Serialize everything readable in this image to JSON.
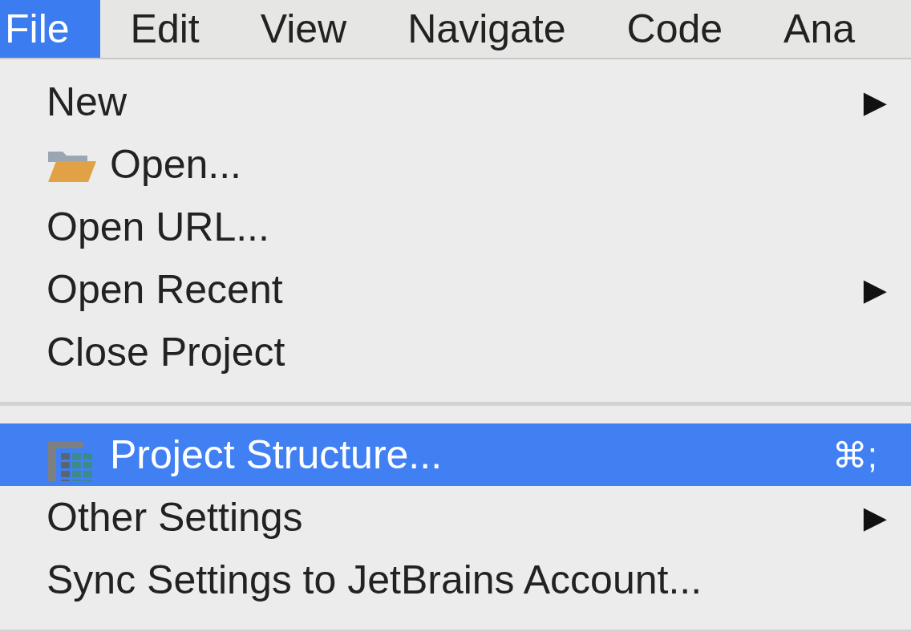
{
  "menubar": [
    {
      "label": "File",
      "selected": true
    },
    {
      "label": "Edit",
      "selected": false
    },
    {
      "label": "View",
      "selected": false
    },
    {
      "label": "Navigate",
      "selected": false
    },
    {
      "label": "Code",
      "selected": false
    },
    {
      "label": "Ana",
      "selected": false
    }
  ],
  "menu": {
    "items": [
      {
        "kind": "plain",
        "label": "New",
        "arrow": "▶",
        "selected": false
      },
      {
        "kind": "folder",
        "label": "Open...",
        "selected": false
      },
      {
        "kind": "plain",
        "label": "Open URL...",
        "selected": false
      },
      {
        "kind": "plain",
        "label": "Open Recent",
        "arrow": "▶",
        "selected": false
      },
      {
        "kind": "plain",
        "label": "Close Project",
        "selected": false
      },
      {
        "kind": "separator"
      },
      {
        "kind": "structure",
        "label": "Project Structure...",
        "shortcut": "⌘;",
        "selected": true
      },
      {
        "kind": "plain",
        "label": "Other Settings",
        "arrow": "▶",
        "selected": false
      },
      {
        "kind": "plain",
        "label": "Sync Settings to JetBrains Account...",
        "selected": false
      },
      {
        "kind": "separator"
      }
    ]
  }
}
